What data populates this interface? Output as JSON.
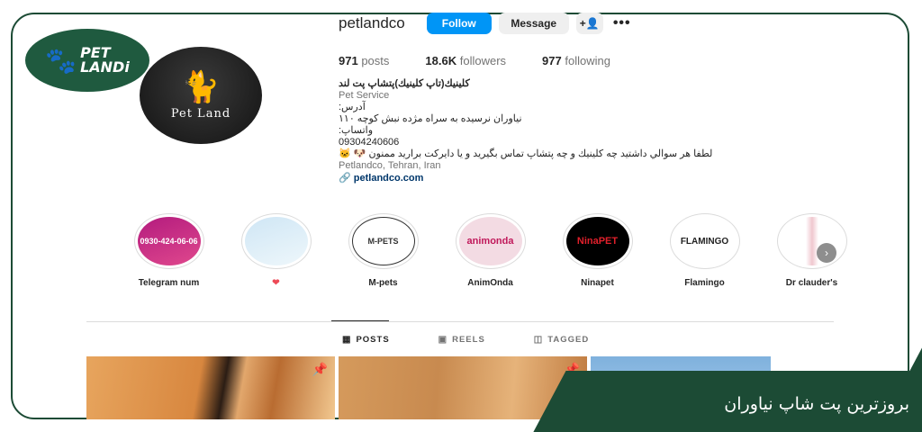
{
  "brand": {
    "logo_line1": "PET",
    "logo_line2": "LANDi"
  },
  "profile": {
    "avatar_text": "Pet Land",
    "username": "petlandco",
    "follow_label": "Follow",
    "message_label": "Message",
    "add_user_icon": "+👤",
    "more_icon": "•••"
  },
  "stats": {
    "posts_count": "971",
    "posts_label": "posts",
    "followers_count": "18.6K",
    "followers_label": "followers",
    "following_count": "977",
    "following_label": "following"
  },
  "bio": {
    "name": "كلينيك(تاپ كلينيك)پتشاپ پت لند",
    "category": "Pet Service",
    "line1": "آدرس:",
    "line2": "نياوران نرسيده به سراه مژده نبش كوچه ١١٠",
    "line3": "واتساپ:",
    "phone": "09304240606",
    "line4": "لطفا هر سوالي داشتيد چه كلينيك و چه پتشاپ تماس بگيريد و يا دايركت براريد ممنون 🐶 🐱",
    "location": "Petlandco, Tehran, Iran",
    "link": "petlandco.com"
  },
  "highlights": [
    {
      "label": "Telegram num",
      "inner": "0930-424-06-06"
    },
    {
      "label": "❤",
      "inner": ""
    },
    {
      "label": "M-pets",
      "inner": "M-PETS"
    },
    {
      "label": "AnimOnda",
      "inner": "animonda"
    },
    {
      "label": "Ninapet",
      "inner": "NinaPET"
    },
    {
      "label": "Flamingo",
      "inner": "FLAMINGO"
    },
    {
      "label": "Dr clauder's",
      "inner": ""
    }
  ],
  "tabs": {
    "posts": "POSTS",
    "reels": "REELS",
    "tagged": "TAGGED"
  },
  "banner": {
    "text": "بروزترین پت شاپ نیاوران"
  },
  "colors": {
    "brand_green": "#1c4b35",
    "follow_blue": "#0095f6"
  }
}
